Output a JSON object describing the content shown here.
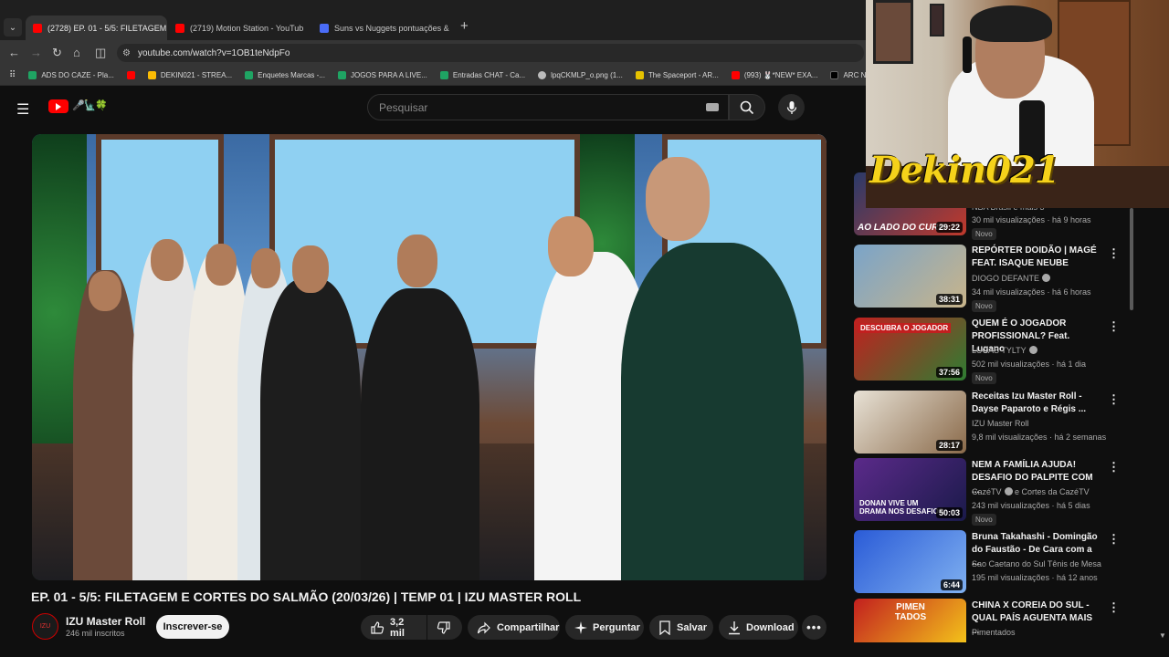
{
  "browser": {
    "tabs": [
      {
        "label": "(2728) EP. 01 - 5/5: FILETAGEM",
        "favicon_color": "#ff0000",
        "active": true
      },
      {
        "label": "(2719) Motion Station - YouTub",
        "favicon_color": "#ff0000",
        "active": false
      },
      {
        "label": "Suns vs Nuggets pontuações &",
        "favicon_color": "#4a6cf7",
        "active": false
      }
    ],
    "url": "youtube.com/watch?v=1OB1teNdpFo",
    "bookmarks": [
      {
        "label": "ADS DO CAZE - Pla...",
        "favicon_color": "#1fa463"
      },
      {
        "label": "",
        "favicon_color": "#ff0000"
      },
      {
        "label": "DEKIN021 - STREA...",
        "favicon_color": "#fbbc04"
      },
      {
        "label": "Enquetes Marcas -...",
        "favicon_color": "#1fa463"
      },
      {
        "label": "JOGOS PARA A LIVE...",
        "favicon_color": "#1fa463"
      },
      {
        "label": "Entradas CHAT - Ca...",
        "favicon_color": "#1fa463"
      },
      {
        "label": "lpqCKMLP_o.png (1...",
        "favicon_color": "#bbbbbb"
      },
      {
        "label": "The Spaceport - AR...",
        "favicon_color": "#e6c200"
      },
      {
        "label": "(993) 🐰*NEW* EXA...",
        "favicon_color": "#ff0000"
      },
      {
        "label": "ARC Now on X",
        "favicon_color": "#000000"
      }
    ]
  },
  "youtube": {
    "search_placeholder": "Pesquisar",
    "logo_doodle": "🎤🗽🍀"
  },
  "video": {
    "title": "EP. 01 - 5/5: FILETAGEM E CORTES DO SALMÃO (20/03/26) | TEMP 01 | IZU MASTER ROLL",
    "channel": "IZU Master Roll",
    "channel_avatar_text": "IZU",
    "subscribers": "246 mil inscritos",
    "subscribe_label": "Inscrever-se",
    "likes": "3,2 mil",
    "share_label": "Compartilhar",
    "ask_label": "Perguntar",
    "save_label": "Salvar",
    "download_label": "Download"
  },
  "recommendations": [
    {
      "title": "",
      "channel": "NBA Brasil e mais 3",
      "meta": "30 mil visualizações · há 9 horas",
      "duration": "29:22",
      "badge": "Novo",
      "thumb_text": "AO LADO DO CURR",
      "thumb_colors": [
        "#2a3a6a",
        "#c0392b"
      ]
    },
    {
      "title": "REPÓRTER DOIDÃO | MAGÉ FEAT. ISAQUE NEUBE",
      "channel": "DIOGO DEFANTE",
      "verified": true,
      "meta": "34 mil visualizações · há 6 horas",
      "duration": "38:31",
      "badge": "Novo",
      "thumb_text": "",
      "thumb_colors": [
        "#7aa4c9",
        "#c8b48a"
      ]
    },
    {
      "title": "QUEM É O JOGADOR PROFISSIONAL? Feat. Lugano",
      "channel": "LUCAS TYLTY",
      "verified": true,
      "meta": "502 mil visualizações · há 1 dia",
      "duration": "37:56",
      "badge": "Novo",
      "thumb_text": "DESCUBRA O JOGADOR",
      "thumb_colors": [
        "#c21f1f",
        "#2e7d32"
      ]
    },
    {
      "title": "Receitas Izu Master Roll - Dayse Paparoto e Régis ...",
      "channel": "IZU Master Roll",
      "verified": false,
      "meta": "9,8 mil visualizações · há 2 semanas",
      "duration": "28:17",
      "badge": "",
      "thumb_text": "",
      "thumb_colors": [
        "#e8e2d6",
        "#8a6a4a"
      ]
    },
    {
      "title": "NEM A FAMÍLIA AJUDA! DESAFIO DO PALPITE COM ...",
      "channel": "CazéTV",
      "channel_extra": "e Cortes da CazéTV",
      "verified": true,
      "meta": "243 mil visualizações · há 5 dias",
      "duration": "50:03",
      "badge": "Novo",
      "thumb_text": "DONAN VIVE UM DRAMA NOS DESAFIOS",
      "thumb_colors": [
        "#5b2a8a",
        "#1a1a4a"
      ]
    },
    {
      "title": "Bruna Takahashi - Domingão do Faustão - De Cara com a ...",
      "channel": "Sao Caetano do Sul Tênis de Mesa",
      "verified": false,
      "meta": "195 mil visualizações · há 12 anos",
      "duration": "6:44",
      "badge": "",
      "thumb_text": "",
      "thumb_colors": [
        "#2a5bd7",
        "#7fb0f0"
      ]
    },
    {
      "title": "CHINA X COREIA DO SUL - QUAL PAÍS AGUENTA MAIS ...",
      "channel": "Pimentados",
      "verified": false,
      "meta": "",
      "duration": "",
      "badge": "",
      "thumb_text": "PIMEN TADOS",
      "thumb_colors": [
        "#c21f1f",
        "#f3c21a"
      ]
    }
  ],
  "webcam": {
    "overlay_name": "Dekin021"
  }
}
